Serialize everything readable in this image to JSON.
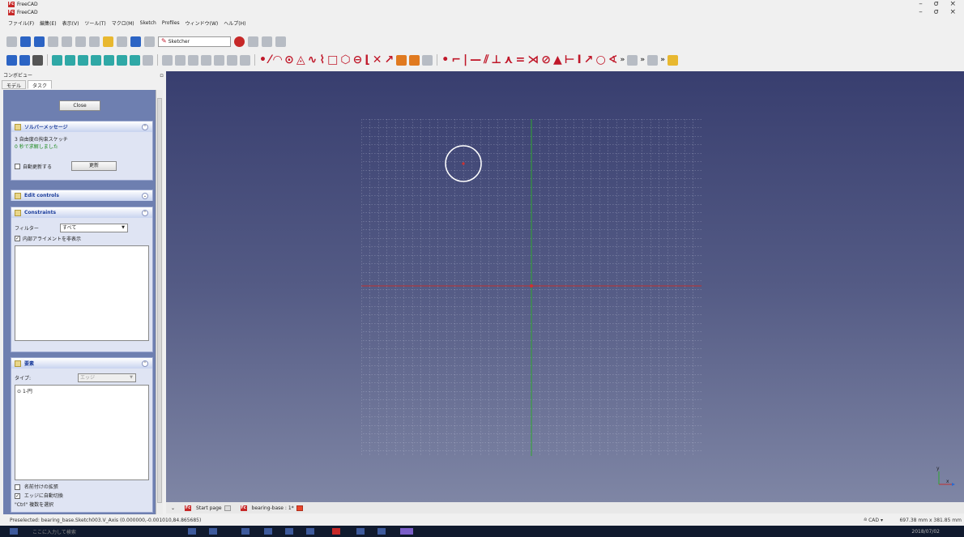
{
  "window": {
    "title_outer": "FreeCAD",
    "title_inner": "FreeCAD",
    "minimize": "–",
    "restore": "σ",
    "close": "×"
  },
  "menu": [
    "ファイル(F)",
    "編集(E)",
    "表示(V)",
    "ツール(T)",
    "マクロ(M)",
    "Sketch",
    "Profiles",
    "ウィンドウ(W)",
    "ヘルプ(H)"
  ],
  "toolbar": {
    "workbench": "Sketcher"
  },
  "combo": {
    "header": "コンボビュー",
    "tabs": [
      "モデル",
      "タスク"
    ],
    "active_tab": "タスク",
    "close": "Close"
  },
  "solver": {
    "title": "ソルバーメッセージ",
    "dof": "3 自由度の拘束スケッチ",
    "solved": "0 秒で求解しました",
    "auto_update": "自動更新する",
    "update_btn": "更新"
  },
  "edit_controls": {
    "title": "Edit controls"
  },
  "constraints": {
    "title": "Constraints",
    "filter_label": "フィルター",
    "filter_value": "すべて",
    "hide_internal": "内部アライメントを非表示"
  },
  "elements": {
    "title": "要素",
    "type_label": "タイプ:",
    "type_value": "エッジ",
    "items": [
      "1-円"
    ],
    "extended_naming": "名前付けの拡張",
    "auto_switch_edge": "エッジに自動切換",
    "ctrl_hint": "\"Ctrl\" 複数を選択"
  },
  "doc_tabs": [
    {
      "label": "Start page"
    },
    {
      "label": "bearing-base : 1*"
    }
  ],
  "status": {
    "message": "Preselected: bearing_base.Sketch003.V_Axis (0.000000,-0.001010,84.865685)",
    "nav_style": "CAD",
    "dimensions": "697.38 mm x 381.85 mm"
  },
  "taskbar": {
    "search_placeholder": "ここに入力して検索",
    "date": "2018/07/02"
  },
  "colors": {
    "viewport_top": "#383e6f",
    "viewport_bottom": "#7f86a5",
    "panel_bg": "#6e7fb0",
    "x_axis": "#c03030",
    "y_axis": "#2ea82e",
    "grid": "#c8cce0"
  }
}
